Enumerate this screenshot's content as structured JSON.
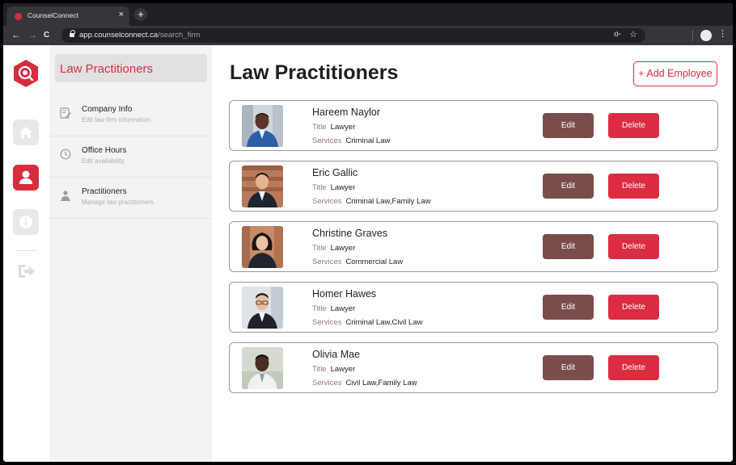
{
  "browser": {
    "tab_title": "CounselConnect",
    "tab_close": "×",
    "new_tab": "+",
    "nav": {
      "back": "←",
      "forward": "→",
      "reload": "C"
    },
    "url_host": "app.counselconnect.ca",
    "url_path": "/search_firm",
    "key_icon": "o-",
    "star_icon": "☆",
    "menu_icon": "⋮"
  },
  "rail": {
    "items": [
      {
        "name": "home",
        "icon": "home-icon",
        "active": false
      },
      {
        "name": "profile",
        "icon": "user-icon",
        "active": true
      },
      {
        "name": "info",
        "icon": "info-icon",
        "active": false
      },
      {
        "name": "logout",
        "icon": "logout-icon",
        "active": false
      }
    ]
  },
  "subnav": {
    "header": "Law Practitioners",
    "items": [
      {
        "label": "Company Info",
        "sub": "Edit law firm information",
        "icon": "edit-document-icon"
      },
      {
        "label": "Office Hours",
        "sub": "Edit availability",
        "icon": "clock-icon"
      },
      {
        "label": "Practitioners",
        "sub": "Manage law practitioners",
        "icon": "people-icon"
      }
    ]
  },
  "main": {
    "title": "Law Practitioners",
    "add_button": "+ Add Employee",
    "title_key": "Title",
    "services_key": "Services",
    "edit_label": "Edit",
    "delete_label": "Delete",
    "practitioners": [
      {
        "name": "Hareem Naylor",
        "title": "Lawyer",
        "services": "Criminal Law"
      },
      {
        "name": "Eric Gallic",
        "title": "Lawyer",
        "services": "Criminal Law,Family Law"
      },
      {
        "name": "Christine Graves",
        "title": "Lawyer",
        "services": "Commercial Law"
      },
      {
        "name": "Homer Hawes",
        "title": "Lawyer",
        "services": "Criminal Law,Civil Law"
      },
      {
        "name": "Olivia Mae",
        "title": "Lawyer",
        "services": "Civil Law,Family Law"
      }
    ]
  },
  "colors": {
    "accent": "#d62d3e",
    "edit_button": "#7a4d4d",
    "delete_button": "#dc2c42",
    "field_key": "#9a7676"
  }
}
